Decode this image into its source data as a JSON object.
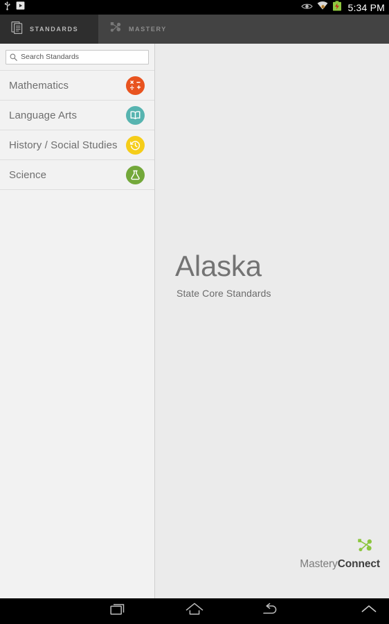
{
  "statusbar": {
    "icons_left": [
      "usb-icon",
      "play-store-icon"
    ],
    "icons_right": [
      "eye-icon",
      "wifi-icon",
      "battery-charging-icon"
    ],
    "time": "5:34 PM"
  },
  "tabs": [
    {
      "label": "STANDARDS",
      "icon": "documents-icon",
      "active": true
    },
    {
      "label": "MASTERY",
      "icon": "nodes-icon",
      "active": false
    }
  ],
  "search": {
    "placeholder": "Search Standards",
    "value": "",
    "icon": "search-icon"
  },
  "subjects": [
    {
      "label": "Mathematics",
      "icon": "math-operators-icon",
      "color": "#e8531f"
    },
    {
      "label": "Language Arts",
      "icon": "open-book-icon",
      "color": "#57b4b0"
    },
    {
      "label": "History / Social Studies",
      "icon": "clock-history-icon",
      "color": "#f5cd19"
    },
    {
      "label": "Science",
      "icon": "flask-icon",
      "color": "#73a83a"
    }
  ],
  "content": {
    "state_name": "Alaska",
    "state_subtitle": "State Core Standards"
  },
  "brand": {
    "name_light": "Mastery",
    "name_bold": "Connect",
    "mark": "nodes-mark-icon",
    "mark_color": "#8cc63f"
  },
  "navbar": {
    "buttons": [
      {
        "name": "recents",
        "icon": "recents-icon"
      },
      {
        "name": "home",
        "icon": "home-icon"
      },
      {
        "name": "back",
        "icon": "back-icon"
      },
      {
        "name": "expand",
        "icon": "chevron-up-icon"
      }
    ]
  },
  "colors": {
    "tabbar_bg": "#434343",
    "tab_active_bg": "#2e2e2e",
    "sidebar_bg": "#f2f2f2",
    "content_bg": "#ebebeb"
  }
}
